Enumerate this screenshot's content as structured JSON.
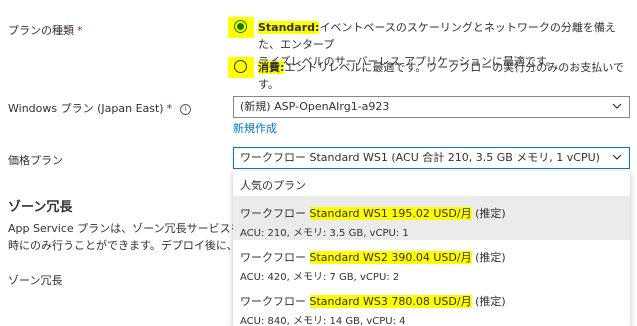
{
  "plan_type": {
    "label": "プランの種類",
    "required": "*",
    "options": [
      {
        "title": "Standard:",
        "description": "イベントベースのスケーリングとネットワークの分離を備えた、エンタープライズレベルのサーバーレス アプリケーションに最適です。",
        "line1": "イベントベースのスケーリングとネットワークの分離を備えた、エンタープ",
        "line2": "ライズレベルのサーバーレス アプリケーションに最適です。",
        "selected": true
      },
      {
        "title": "消費:",
        "description": "エントリレベルに最適です。ワークフローの実行分のみのお支払いです。",
        "selected": false
      }
    ]
  },
  "windows_plan": {
    "label": "Windows プラン (Japan East)",
    "required": "*",
    "info_icon": "info-icon",
    "value": "(新規) ASP-OpenAIrg1-a923",
    "create_new_link": "新規作成"
  },
  "pricing_plan": {
    "label": "価格プラン",
    "value": "ワークフロー Standard WS1 (ACU 合計 210, 3.5 GB メモリ, 1 vCPU)",
    "popup": {
      "header": "人気のプラン",
      "items": [
        {
          "prefix": "ワークフロー ",
          "highlight": "Standard WS1 195.02 USD/月",
          "suffix": " (推定)",
          "details": "ACU: 210, メモリ: 3.5 GB, vCPU: 1"
        },
        {
          "prefix": "ワークフロー ",
          "highlight": "Standard WS2 390.04 USD/月",
          "suffix": " (推定)",
          "details": "ACU: 420, メモリ: 7 GB, vCPU: 2"
        },
        {
          "prefix": "ワークフロー ",
          "highlight": "Standard WS3 780.08 USD/月",
          "suffix": " (推定)",
          "details": "ACU: 840, メモリ: 14 GB, vCPU: 4"
        }
      ]
    }
  },
  "zone_redundancy": {
    "section_title": "ゾーン冗長",
    "description_line1": "App Service プランは、ゾーン冗長サービスをサポー",
    "description_line2": "時にのみ行うことができます。デプロイ後に、App Se",
    "field_label": "ゾーン冗長"
  },
  "colors": {
    "highlight": "#ffff00",
    "link": "#0078d4",
    "radio_selected": "#107c10",
    "required": "#a4262c"
  }
}
